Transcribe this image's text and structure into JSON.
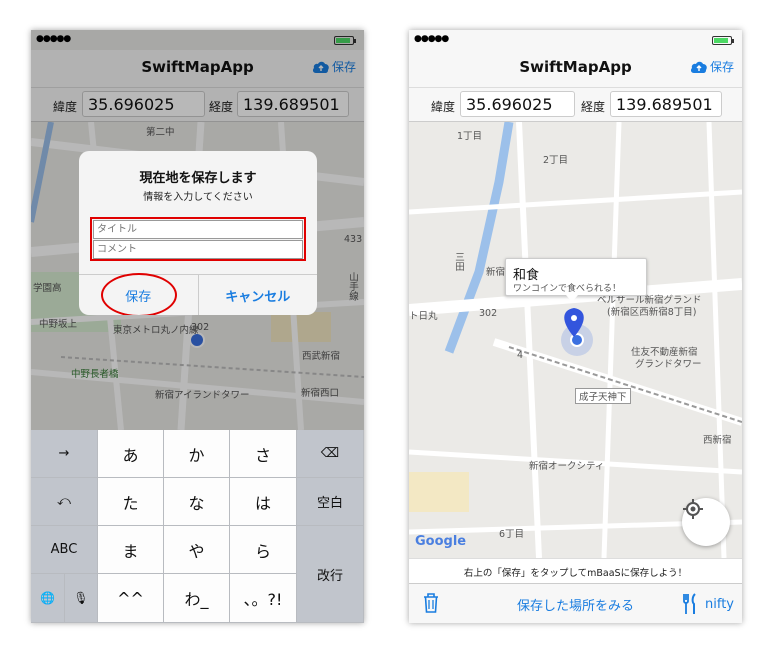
{
  "left": {
    "nav_title": "SwiftMapApp",
    "save_nav_label": "保存",
    "lat_label": "緯度",
    "lat_value": "35.696025",
    "lng_label": "経度",
    "lng_value": "139.689501",
    "map_labels": [
      "第二中",
      "学園高",
      "433",
      "中野坂上",
      "東京メトロ丸ノ内線",
      "302",
      "中野長者橋",
      "西武新宿",
      "新宿アイランドタワー",
      "新宿西口",
      "山手線"
    ],
    "alert": {
      "title": "現在地を保存します",
      "message": "情報を入力してください",
      "title_placeholder": "タイトル",
      "comment_placeholder": "コメント",
      "save_label": "保存",
      "cancel_label": "キャンセル"
    },
    "keyboard": {
      "arrow": "→",
      "row1": [
        "あ",
        "か",
        "さ"
      ],
      "backspace": "⌫",
      "undo": "⤺",
      "row2": [
        "た",
        "な",
        "は"
      ],
      "space": "空白",
      "abc": "ABC",
      "row3": [
        "ま",
        "や",
        "ら"
      ],
      "globe": "🌐",
      "mic": "🎙",
      "row4": [
        "^^",
        "わ_",
        "、。?!"
      ],
      "enter": "改行"
    }
  },
  "right": {
    "nav_title": "SwiftMapApp",
    "save_nav_label": "保存",
    "lat_label": "緯度",
    "lat_value": "35.696025",
    "lng_label": "経度",
    "lng_value": "139.689501",
    "map_labels": [
      "1丁目",
      "2丁目",
      "三田",
      "ト日丸",
      "302",
      "4",
      "新宿",
      "ベルサール新宿グランド",
      "(新宿区西新宿8丁目)",
      "住友不動産新宿",
      "グランドタワー",
      "成子天神下",
      "西新宿",
      "新宿オークシティ",
      "6丁目"
    ],
    "callout_title": "和食",
    "callout_subtitle": "ワンコインで食べられる！",
    "google_logo": "Google",
    "info_text": "右上の「保存」をタップしてmBaaSに保存しよう！",
    "view_saved_label": "保存した場所をみる",
    "nifty_label": "nifty"
  },
  "colors": {
    "accent": "#1a7de0",
    "highlight_red": "#e00000",
    "pin": "#3355dd"
  }
}
